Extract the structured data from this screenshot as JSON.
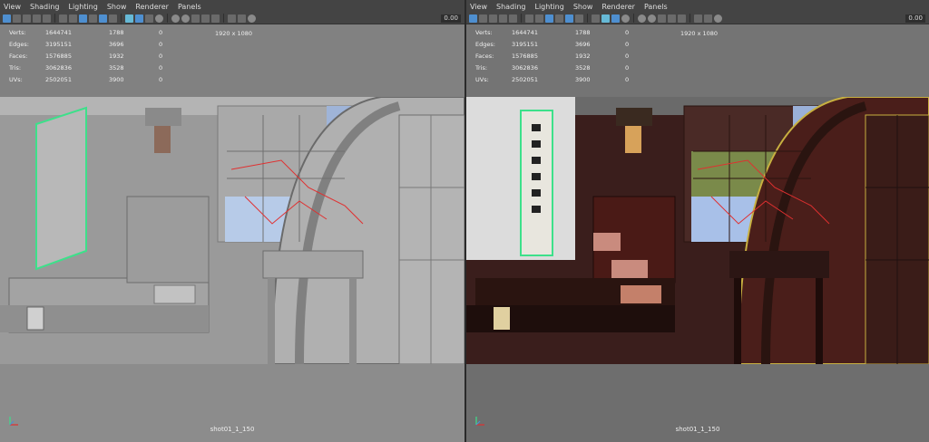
{
  "menu": [
    "View",
    "Shading",
    "Lighting",
    "Show",
    "Renderer",
    "Panels"
  ],
  "toolbar": {
    "value": "0.00"
  },
  "hud": {
    "rows": [
      {
        "label": "Verts:",
        "v1": "1644741",
        "v2": "1788",
        "v3": "0"
      },
      {
        "label": "Edges:",
        "v1": "3195151",
        "v2": "3696",
        "v3": "0"
      },
      {
        "label": "Faces:",
        "v1": "1576885",
        "v2": "1932",
        "v3": "0"
      },
      {
        "label": "Tris:",
        "v1": "3062836",
        "v2": "3528",
        "v3": "0"
      },
      {
        "label": "UVs:",
        "v1": "2502051",
        "v2": "3900",
        "v3": "0"
      }
    ],
    "resolution": "1920 x 1080"
  },
  "camera_label": "shot01_1_150",
  "colors": {
    "accent": "#4e8fd0",
    "selection_green": "#3de08a",
    "curve_red": "#e03030"
  }
}
